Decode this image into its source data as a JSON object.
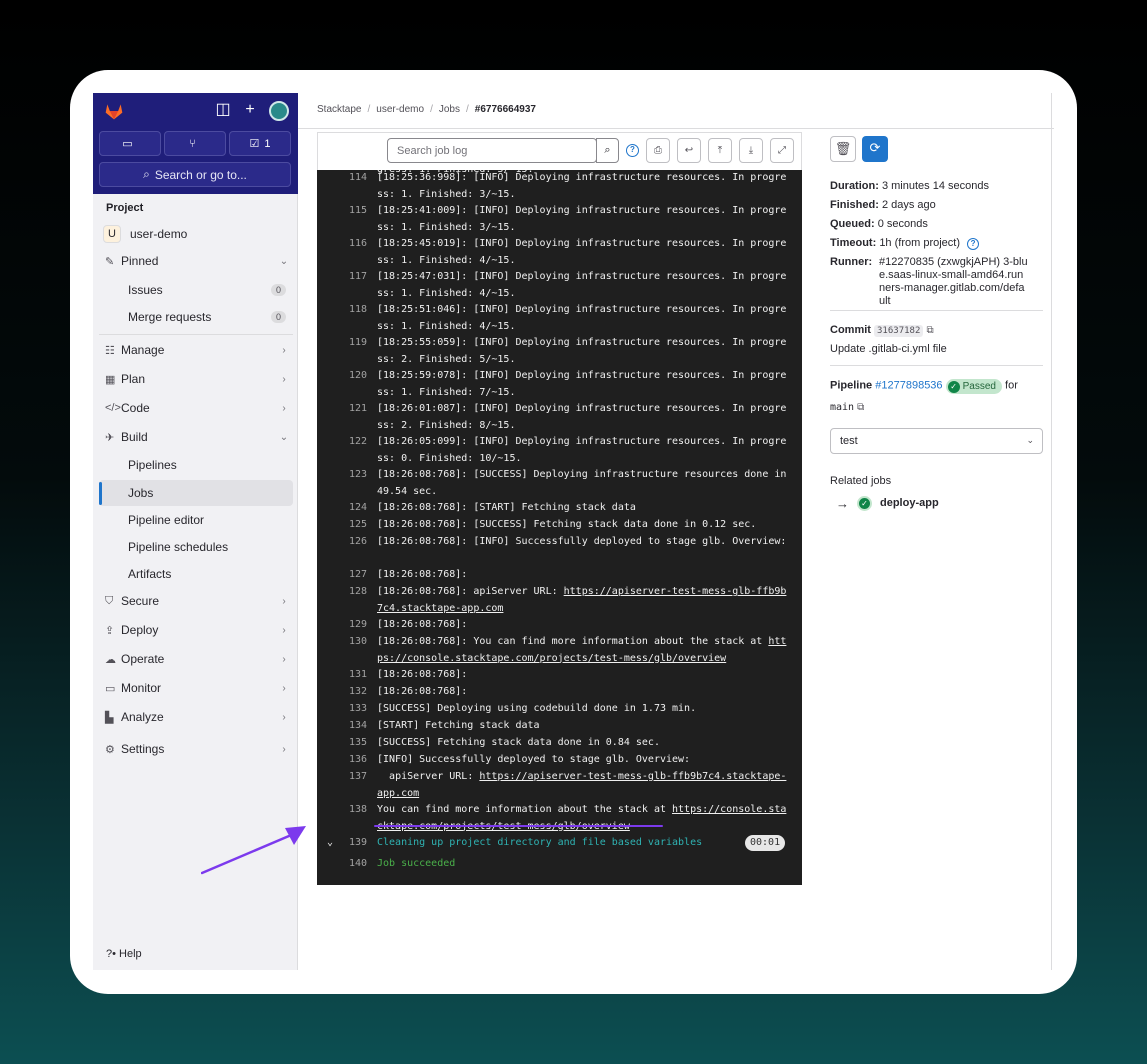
{
  "sidebar": {
    "buttons": {
      "issues_count": "",
      "mr_count": "",
      "todo_count": "1"
    },
    "search": "Search or go to...",
    "project_label": "Project",
    "project": {
      "avatar": "U",
      "name": "user-demo"
    },
    "pinned": "Pinned",
    "issues": "Issues",
    "issues_badge": "0",
    "merge_requests": "Merge requests",
    "mr_badge": "0",
    "manage": "Manage",
    "plan": "Plan",
    "code": "Code",
    "build": "Build",
    "pipelines": "Pipelines",
    "jobs": "Jobs",
    "pipeline_editor": "Pipeline editor",
    "pipeline_schedules": "Pipeline schedules",
    "artifacts": "Artifacts",
    "secure": "Secure",
    "deploy": "Deploy",
    "operate": "Operate",
    "monitor": "Monitor",
    "analyze": "Analyze",
    "settings": "Settings",
    "help": "Help"
  },
  "breadcrumb": [
    "Stacktape",
    "user-demo",
    "Jobs",
    "#6776664937"
  ],
  "log_toolbar": {
    "search_placeholder": "Search job log"
  },
  "log": {
    "top_partial": "gress: 1. Finished: 3/~15.",
    "lines": [
      {
        "n": "114",
        "t": "[18:25:36:998]: [INFO] Deploying infrastructure resources. In progress: 1. Finished: 3/~15."
      },
      {
        "n": "115",
        "t": "[18:25:41:009]: [INFO] Deploying infrastructure resources. In progress: 1. Finished: 3/~15."
      },
      {
        "n": "116",
        "t": "[18:25:45:019]: [INFO] Deploying infrastructure resources. In progress: 1. Finished: 4/~15."
      },
      {
        "n": "117",
        "t": "[18:25:47:031]: [INFO] Deploying infrastructure resources. In progress: 1. Finished: 4/~15."
      },
      {
        "n": "118",
        "t": "[18:25:51:046]: [INFO] Deploying infrastructure resources. In progress: 1. Finished: 4/~15."
      },
      {
        "n": "119",
        "t": "[18:25:55:059]: [INFO] Deploying infrastructure resources. In progress: 2. Finished: 5/~15."
      },
      {
        "n": "120",
        "t": "[18:25:59:078]: [INFO] Deploying infrastructure resources. In progress: 1. Finished: 7/~15."
      },
      {
        "n": "121",
        "t": "[18:26:01:087]: [INFO] Deploying infrastructure resources. In progress: 2. Finished: 8/~15."
      },
      {
        "n": "122",
        "t": "[18:26:05:099]: [INFO] Deploying infrastructure resources. In progress: 0. Finished: 10/~15."
      },
      {
        "n": "123",
        "t": "[18:26:08:768]: [SUCCESS] Deploying infrastructure resources done in 49.54 sec."
      },
      {
        "n": "124",
        "t": "[18:26:08:768]: [START] Fetching stack data"
      },
      {
        "n": "125",
        "t": "[18:26:08:768]: [SUCCESS] Fetching stack data done in 0.12 sec."
      },
      {
        "n": "126",
        "t": "[18:26:08:768]: [INFO] Successfully deployed to stage glb. Overview:"
      },
      {
        "n": "127",
        "t": "[18:26:08:768]:"
      },
      {
        "n": "128",
        "t": "[18:26:08:768]: apiServer URL: ",
        "link": "https://apiserver-test-mess-glb-ffb9b7c4.stacktape-app.com"
      },
      {
        "n": "129",
        "t": "[18:26:08:768]:"
      },
      {
        "n": "130",
        "t": "[18:26:08:768]: You can find more information about the stack at ",
        "link": "https://console.stacktape.com/projects/test-mess/glb/overview"
      },
      {
        "n": "131",
        "t": "[18:26:08:768]:"
      },
      {
        "n": "132",
        "t": "[18:26:08:768]:"
      },
      {
        "n": "133",
        "t": "[SUCCESS] Deploying using codebuild done in 1.73 min."
      },
      {
        "n": "134",
        "t": "[START] Fetching stack data"
      },
      {
        "n": "135",
        "t": "[SUCCESS] Fetching stack data done in 0.84 sec."
      },
      {
        "n": "136",
        "t": "[INFO] Successfully deployed to stage glb. Overview:"
      },
      {
        "n": "137",
        "t": "  apiServer URL: ",
        "link": "https://apiserver-test-mess-glb-ffb9b7c4.stacktape-app.com"
      },
      {
        "n": "138",
        "t": "You can find more information about the stack at ",
        "link": "https://console.stacktape.com/projects/test-mess/glb/overview"
      },
      {
        "n": "139",
        "t": "Cleaning up project directory and file based variables",
        "duration": "00:01"
      },
      {
        "n": "140",
        "t": "Job succeeded"
      }
    ]
  },
  "job": {
    "duration_label": "Duration:",
    "duration": "3 minutes 14 seconds",
    "finished_label": "Finished:",
    "finished": "2 days ago",
    "queued_label": "Queued:",
    "queued": "0 seconds",
    "timeout_label": "Timeout:",
    "timeout": "1h (from project)",
    "runner_label": "Runner:",
    "runner": "#12270835 (zxwgkjAPH) 3-blue.saas-linux-small-amd64.runners-manager.gitlab.com/default",
    "commit_label": "Commit",
    "commit_sha": "31637182",
    "commit_message": "Update .gitlab-ci.yml file",
    "pipeline_label": "Pipeline",
    "pipeline_id": "#1277898536",
    "pipeline_status": "Passed",
    "for_label": "for",
    "ref": "main",
    "stage": "test",
    "related_jobs_label": "Related jobs",
    "related_job": "deploy-app"
  },
  "colors": {
    "nav_bg": "#1f1e7a",
    "log_bg": "#1f1f1f",
    "link": "#1f75cb",
    "passed": "#108548",
    "annotation": "#7c3aed"
  }
}
